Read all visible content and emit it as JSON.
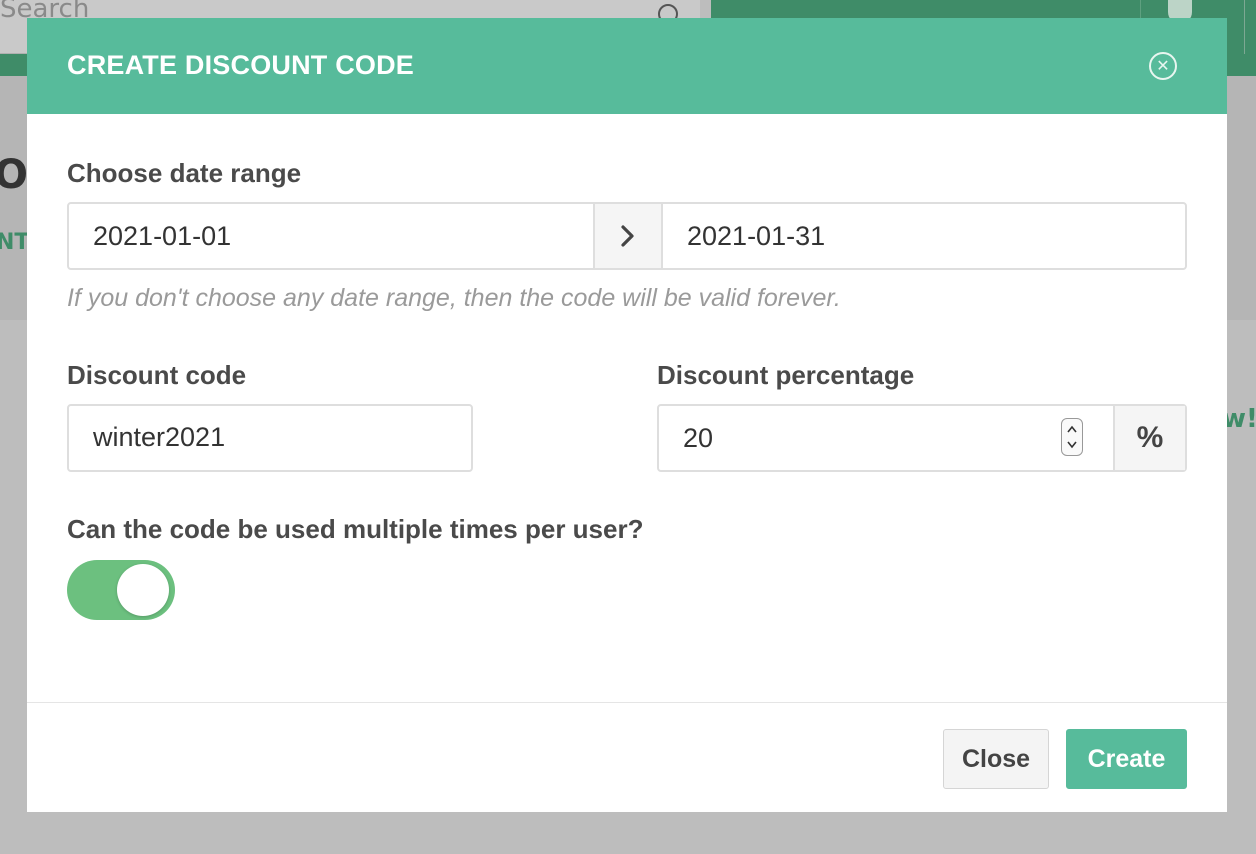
{
  "background": {
    "search_placeholder": "Search",
    "title_fragment": "O",
    "link_fragment": "NT",
    "new_fragment": "w!"
  },
  "modal": {
    "title": "CREATE DISCOUNT CODE",
    "close_icon": "close-circle-icon",
    "date_range": {
      "label": "Choose date range",
      "start": "2021-01-01",
      "separator_icon": "chevron-right-icon",
      "end": "2021-01-31",
      "hint": "If you don't choose any date range, then the code will be valid forever."
    },
    "discount_code": {
      "label": "Discount code",
      "value": "winter2021"
    },
    "discount_percentage": {
      "label": "Discount percentage",
      "value": "20",
      "addon": "%"
    },
    "multiple_use": {
      "label": "Can the code be used multiple times per user?",
      "enabled": true
    },
    "footer": {
      "close_label": "Close",
      "create_label": "Create"
    }
  },
  "colors": {
    "accent": "#57bb9b",
    "toggle_on": "#6cc07f",
    "topbar": "#3f8c68"
  }
}
